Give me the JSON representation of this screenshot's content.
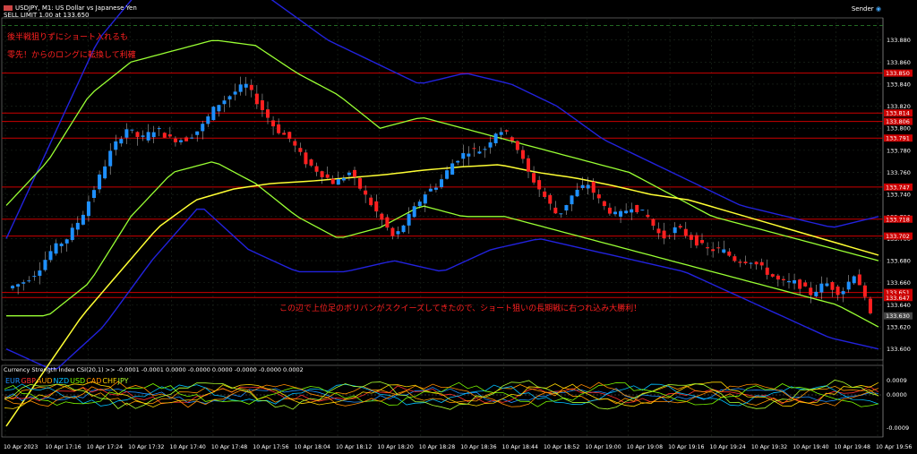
{
  "window": {
    "title": "USDJPY, M1:  US Dollar vs Japanese Yen",
    "order_line": "SELL LIMIT 1.00 at 133.650",
    "sender": "Sender"
  },
  "annotations": {
    "line1": "後半戦狙りずにショート入れるも",
    "line2": "零先！からのロングに転換して利確",
    "line3": "この辺で上位足のボリバンがスクイーズしてきたので、ショート狙いの長期戦に右つれ込み大勝利！"
  },
  "indicator": {
    "title": "Currency Strength Index CSI(20,1) >> -0.0001 -0.0001 0.0000 -0.0000 0.0000 -0.0000 -0.0000 0.0002",
    "currencies": [
      {
        "name": "EUR",
        "color": "#1e90ff"
      },
      {
        "name": "GBP",
        "color": "#ff3030"
      },
      {
        "name": "AUD",
        "color": "#ff9900"
      },
      {
        "name": "NZD",
        "color": "#00bfff"
      },
      {
        "name": "USD",
        "color": "#7cfc00"
      },
      {
        "name": "CAD",
        "color": "#ff8c00"
      },
      {
        "name": "CHF",
        "color": "#ffd700"
      },
      {
        "name": "JPY",
        "color": "#adff2f"
      }
    ],
    "ticks": [
      "0.0009",
      "0.0000",
      "-0.0009"
    ]
  },
  "colors": {
    "bull": "#1e90ff",
    "bear": "#ff2020",
    "grid": "#1f2a1f",
    "hline": "#cc0000",
    "ma": "#ffff33",
    "bb_inner": "#99ff33",
    "bb_outer": "#2222dd"
  },
  "chart_data": {
    "type": "candlestick",
    "symbol": "USDJPY",
    "timeframe": "M1",
    "ylim": [
      133.59,
      133.9
    ],
    "y_ticks": [
      "133.880",
      "133.860",
      "133.840",
      "133.820",
      "133.800",
      "133.780",
      "133.760",
      "133.740",
      "133.720",
      "133.700",
      "133.680",
      "133.660",
      "133.640",
      "133.620",
      "133.600"
    ],
    "x_ticks": [
      "10 Apr 2023",
      "10 Apr 17:16",
      "10 Apr 17:24",
      "10 Apr 17:32",
      "10 Apr 17:40",
      "10 Apr 17:48",
      "10 Apr 17:56",
      "10 Apr 18:04",
      "10 Apr 18:12",
      "10 Apr 18:20",
      "10 Apr 18:28",
      "10 Apr 18:36",
      "10 Apr 18:44",
      "10 Apr 18:52",
      "10 Apr 19:00",
      "10 Apr 19:08",
      "10 Apr 19:16",
      "10 Apr 19:24",
      "10 Apr 19:32",
      "10 Apr 19:40",
      "10 Apr 19:48",
      "10 Apr 19:56"
    ],
    "price_labels": [
      {
        "text": "133.850",
        "value": 133.85
      },
      {
        "text": "133.814",
        "value": 133.8138
      },
      {
        "text": "133.806",
        "value": 133.8062
      },
      {
        "text": "133.791",
        "value": 133.7911
      },
      {
        "text": "133.747",
        "value": 133.7467
      },
      {
        "text": "133.718",
        "value": 133.7176
      },
      {
        "text": "133.702",
        "value": 133.7023
      },
      {
        "text": "133.651",
        "value": 133.6512
      },
      {
        "text": "133.647",
        "value": 133.6466
      },
      {
        "text": "133.630",
        "value": 133.63
      }
    ],
    "close_path": [
      133.655,
      133.66,
      133.67,
      133.69,
      133.7,
      133.72,
      133.75,
      133.78,
      133.8,
      133.79,
      133.8,
      133.79,
      133.79,
      133.8,
      133.82,
      133.83,
      133.84,
      133.82,
      133.8,
      133.79,
      133.77,
      133.76,
      133.75,
      133.76,
      133.74,
      133.72,
      133.7,
      133.72,
      133.74,
      133.75,
      133.77,
      133.78,
      133.78,
      133.8,
      133.79,
      133.76,
      133.74,
      133.72,
      133.74,
      133.75,
      133.73,
      133.72,
      133.73,
      133.72,
      133.7,
      133.71,
      133.7,
      133.69,
      133.69,
      133.68,
      133.68,
      133.67,
      133.66,
      133.66,
      133.65,
      133.66,
      133.65,
      133.67,
      133.63
    ],
    "ma_path": [
      133.53,
      133.58,
      133.63,
      133.67,
      133.71,
      133.735,
      133.745,
      133.75,
      133.752,
      133.755,
      133.758,
      133.762,
      133.765,
      133.767,
      133.76,
      133.755,
      133.748,
      133.74,
      133.735,
      133.725,
      133.715,
      133.705,
      133.695,
      133.685
    ],
    "bb_inner_upper": [
      133.73,
      133.77,
      133.83,
      133.86,
      133.87,
      133.88,
      133.875,
      133.85,
      133.83,
      133.8,
      133.81,
      133.8,
      133.79,
      133.78,
      133.77,
      133.76,
      133.74,
      133.72,
      133.71,
      133.7,
      133.69,
      133.68
    ],
    "bb_inner_lower": [
      133.63,
      133.63,
      133.66,
      133.72,
      133.76,
      133.77,
      133.75,
      133.72,
      133.7,
      133.71,
      133.73,
      133.72,
      133.72,
      133.71,
      133.7,
      133.69,
      133.68,
      133.67,
      133.66,
      133.65,
      133.64,
      133.62
    ],
    "bb_outer_upper": [
      133.7,
      133.79,
      133.88,
      133.93,
      133.95,
      133.94,
      133.91,
      133.88,
      133.86,
      133.84,
      133.85,
      133.84,
      133.82,
      133.79,
      133.77,
      133.75,
      133.73,
      133.72,
      133.71,
      133.72
    ],
    "bb_outer_lower": [
      133.6,
      133.58,
      133.62,
      133.68,
      133.73,
      133.69,
      133.67,
      133.67,
      133.68,
      133.67,
      133.69,
      133.7,
      133.69,
      133.68,
      133.67,
      133.65,
      133.63,
      133.61,
      133.6
    ]
  }
}
